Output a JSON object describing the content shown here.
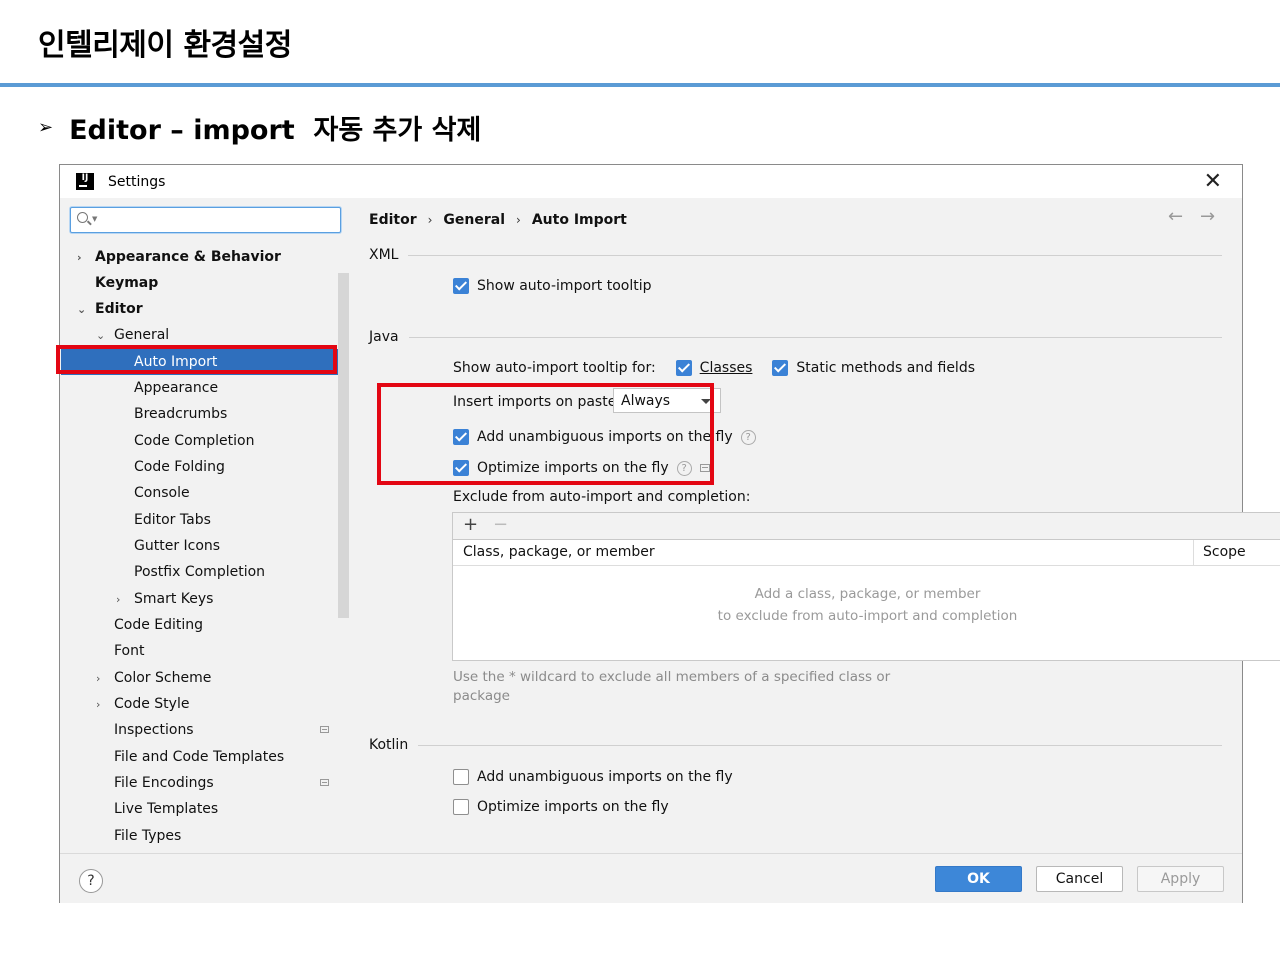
{
  "slide": {
    "title": "인텔리제이 환경설정",
    "bullet_arrow": "➢",
    "bullet_text": "Editor – import  자동 추가 삭제"
  },
  "window": {
    "title": "Settings",
    "logo": "IJ",
    "close_glyph": "✕"
  },
  "sidebar": {
    "search_placeholder": "",
    "items": [
      {
        "label": "Appearance & Behavior"
      },
      {
        "label": "Keymap"
      },
      {
        "label": "Editor"
      },
      {
        "label": "General"
      },
      {
        "label": "Auto Import"
      },
      {
        "label": "Appearance"
      },
      {
        "label": "Breadcrumbs"
      },
      {
        "label": "Code Completion"
      },
      {
        "label": "Code Folding"
      },
      {
        "label": "Console"
      },
      {
        "label": "Editor Tabs"
      },
      {
        "label": "Gutter Icons"
      },
      {
        "label": "Postfix Completion"
      },
      {
        "label": "Smart Keys"
      },
      {
        "label": "Code Editing"
      },
      {
        "label": "Font"
      },
      {
        "label": "Color Scheme"
      },
      {
        "label": "Code Style"
      },
      {
        "label": "Inspections"
      },
      {
        "label": "File and Code Templates"
      },
      {
        "label": "File Encodings"
      },
      {
        "label": "Live Templates"
      },
      {
        "label": "File Types"
      }
    ],
    "selected": "Auto Import"
  },
  "breadcrumb": {
    "items": [
      "Editor",
      "General",
      "Auto Import"
    ],
    "separator": "›",
    "back": "←",
    "forward": "→"
  },
  "xml": {
    "section_label": "XML",
    "show_tooltip_label": "Show auto-import tooltip",
    "show_tooltip_checked": true
  },
  "java": {
    "section_label": "Java",
    "tooltip_for_label": "Show auto-import tooltip for:",
    "classes_label": "Classes",
    "classes_checked": true,
    "static_label": "Static methods and fields",
    "static_checked": true,
    "insert_on_paste_label": "Insert imports on paste:",
    "insert_on_paste_value": "Always",
    "add_unambiguous_label": "Add unambiguous imports on the fly",
    "add_unambiguous_checked": true,
    "optimize_label": "Optimize imports on the fly",
    "optimize_checked": true,
    "help_glyph": "?",
    "exclude_label": "Exclude from auto-import and completion:",
    "table": {
      "add": "+",
      "remove": "−",
      "col_member": "Class, package, or member",
      "col_scope": "Scope",
      "empty_line1": "Add a class, package, or member",
      "empty_line2": "to exclude from auto-import and completion"
    },
    "hint": "Use the * wildcard to exclude all members of a specified class or package"
  },
  "kotlin": {
    "section_label": "Kotlin",
    "add_unambiguous_label": "Add unambiguous imports on the fly",
    "add_unambiguous_checked": false,
    "optimize_label": "Optimize imports on the fly",
    "optimize_checked": false
  },
  "footer": {
    "help": "?",
    "ok": "OK",
    "cancel": "Cancel",
    "apply": "Apply"
  },
  "colors": {
    "accent": "#2f6fbd",
    "highlight": "#e30613",
    "slide_rule": "#5b9bd5"
  }
}
